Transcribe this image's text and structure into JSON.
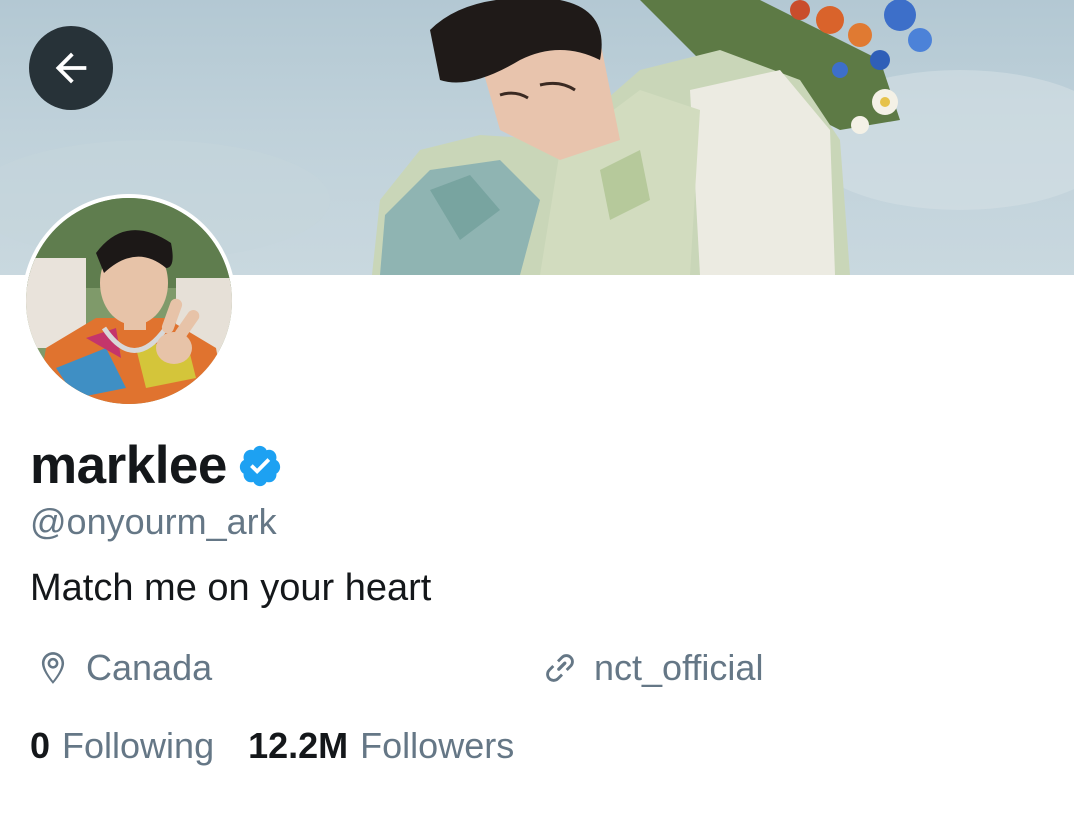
{
  "header": {
    "back_icon": "arrow-left-icon",
    "banner_image": "header-photo"
  },
  "profile": {
    "avatar": "profile-photo",
    "name": "marklee",
    "verified_icon": "verified-badge-icon",
    "handle": "@onyourm_ark",
    "bio": "Match me on your heart",
    "location_icon": "location-pin-icon",
    "location": "Canada",
    "link_icon": "link-icon",
    "website": "nct_official"
  },
  "stats": {
    "following_count": "0",
    "following_label": "Following",
    "followers_count": "12.2M",
    "followers_label": "Followers"
  },
  "colors": {
    "accent": "#1da1f2",
    "secondary_text": "#657786",
    "primary_text": "#14171a",
    "back_button_bg": "#273238"
  }
}
